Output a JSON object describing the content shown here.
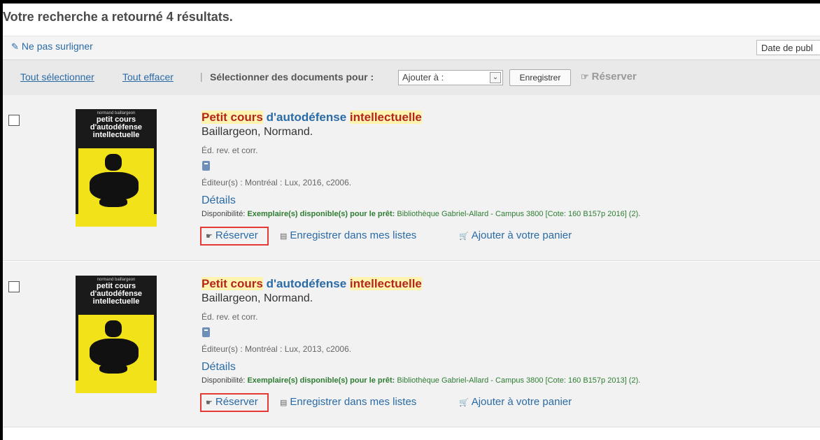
{
  "header": {
    "results_count_text": "Votre recherche a retourné 4 résultats."
  },
  "highlight": {
    "toggle_label": "Ne pas surligner",
    "sort_value": "Date de publ"
  },
  "toolbar": {
    "select_all": "Tout sélectionner",
    "clear_all": "Tout effacer",
    "separator": "|",
    "select_docs_label": "Sélectionner des documents pour :",
    "add_to_value": "Ajouter à :",
    "save_button": "Enregistrer",
    "reserve_label": "Réserver"
  },
  "results": [
    {
      "cover": {
        "author": "normand baillargeon",
        "title": "petit cours d'autodéfense intellectuelle"
      },
      "title_parts": [
        "Petit cours",
        "d'autodéfense",
        "intellectuelle"
      ],
      "author": "Baillargeon, Normand.",
      "edition": "Éd. rev. et corr.",
      "publisher": "Éditeur(s) : Montréal : Lux, 2016, c2006.",
      "details": "Détails",
      "availability_label": "Disponibilité:",
      "availability_status": "Exemplaire(s) disponible(s) pour le prêt:",
      "availability_location": "Bibliothèque Gabriel-Allard - Campus 3800 [Cote: 160 B157p 2016] (2).",
      "actions": {
        "reserve": "Réserver",
        "save_lists": "Enregistrer dans mes listes",
        "add_cart": "Ajouter à votre panier"
      }
    },
    {
      "cover": {
        "author": "normand baillargeon",
        "title": "petit cours d'autodéfense intellectuelle"
      },
      "title_parts": [
        "Petit cours",
        "d'autodéfense",
        "intellectuelle"
      ],
      "author": "Baillargeon, Normand.",
      "edition": "Éd. rev. et corr.",
      "publisher": "Éditeur(s) : Montréal : Lux, 2013, c2006.",
      "details": "Détails",
      "availability_label": "Disponibilité:",
      "availability_status": "Exemplaire(s) disponible(s) pour le prêt:",
      "availability_location": "Bibliothèque Gabriel-Allard - Campus 3800 [Cote: 160 B157p 2013] (2).",
      "actions": {
        "reserve": "Réserver",
        "save_lists": "Enregistrer dans mes listes",
        "add_cart": "Ajouter à votre panier"
      }
    }
  ],
  "icons": {
    "pencil": "pencil-icon",
    "reserve": "hand-icon",
    "list": "list-icon",
    "cart": "cart-icon",
    "book": "book-icon"
  }
}
